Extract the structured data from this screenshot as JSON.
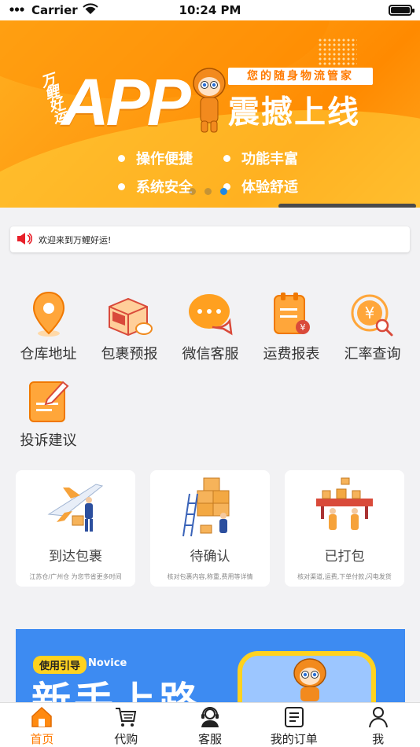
{
  "status": {
    "carrier": "Carrier",
    "time": "10:24 PM",
    "battery_level": 1.0
  },
  "banner": {
    "brand": "万鲤好运",
    "headline": "APP",
    "tagline": "您的随身物流管家",
    "launch": "震撼上线",
    "features": [
      "操作便捷",
      "功能丰富",
      "系统安全",
      "体验舒适"
    ],
    "pager": {
      "count": 3,
      "active": 3
    }
  },
  "notice": {
    "icon": "speaker-icon",
    "text": "欢迎来到万鲤好运!"
  },
  "menu": [
    {
      "label": "仓库地址",
      "icon": "location-pin-icon"
    },
    {
      "label": "包裹预报",
      "icon": "parcel-box-icon"
    },
    {
      "label": "微信客服",
      "icon": "chat-bubble-icon"
    },
    {
      "label": "运费报表",
      "icon": "fee-report-icon"
    },
    {
      "label": "汇率查询",
      "icon": "exchange-rate-icon"
    },
    {
      "label": "投诉建议",
      "icon": "feedback-edit-icon"
    }
  ],
  "cards": [
    {
      "title": "到达包裹",
      "subtitle": "江苏仓/广州仓 为您节省更多时间",
      "icon": "airplane-delivery-illustration"
    },
    {
      "title": "待确认",
      "subtitle": "核对包裹内容,称重,费用等详情",
      "icon": "warehouse-boxes-illustration"
    },
    {
      "title": "已打包",
      "subtitle": "核对渠道,运费,下单付款,闪电发货",
      "icon": "packing-line-illustration"
    }
  ],
  "novice": {
    "tag": "使用引导",
    "english": "Novice",
    "title": "新手上路"
  },
  "tabs": [
    {
      "label": "首页",
      "icon": "home-icon",
      "active": true
    },
    {
      "label": "代购",
      "icon": "cart-icon",
      "active": false
    },
    {
      "label": "客服",
      "icon": "headset-agent-icon",
      "active": false
    },
    {
      "label": "我的订单",
      "icon": "order-list-icon",
      "active": false
    },
    {
      "label": "我",
      "icon": "person-icon",
      "active": false
    }
  ],
  "colors": {
    "brand_orange": "#ff7a00",
    "accent_yellow": "#ffd21f",
    "novice_blue": "#3d8bf2",
    "pager_active": "#1e88e5"
  }
}
